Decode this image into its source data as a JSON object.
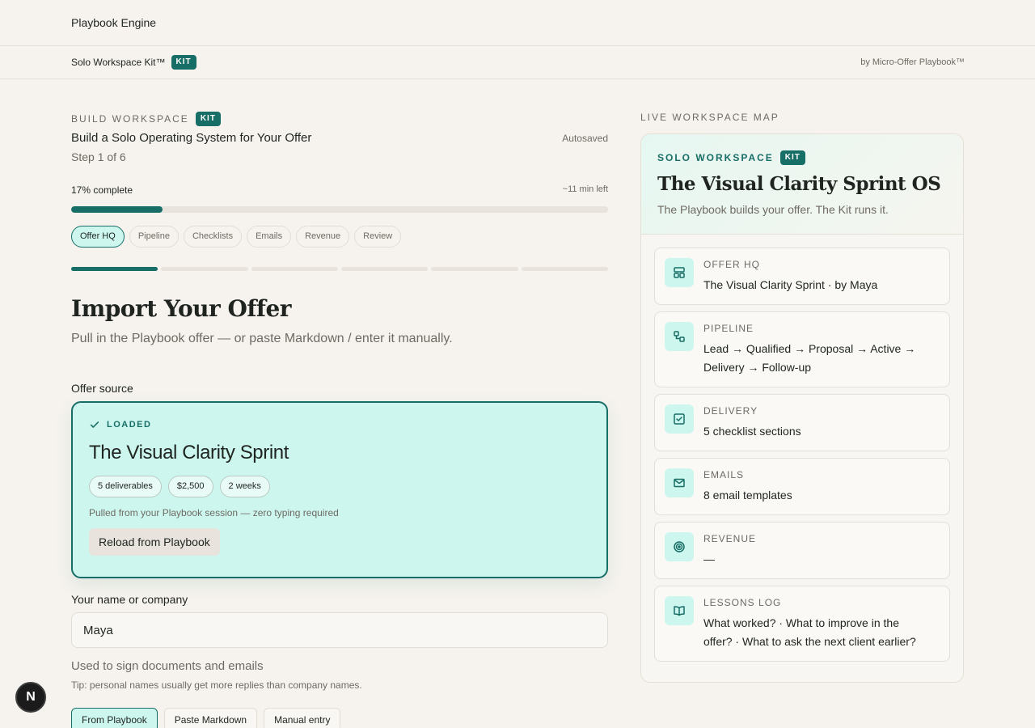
{
  "app": {
    "title": "Playbook Engine"
  },
  "subbar": {
    "product": "Solo Workspace Kit™",
    "kit_badge": "KIT",
    "byline": "by Micro-Offer Playbook™"
  },
  "build": {
    "eyebrow": "BUILD WORKSPACE",
    "badge": "KIT",
    "title": "Build a Solo Operating System for Your Offer",
    "autosaved": "Autosaved",
    "step": "Step 1 of 6",
    "progress_label": "17% complete",
    "progress_value": 17,
    "time_left": "~11 min left"
  },
  "tabs": [
    {
      "label": "Offer HQ",
      "active": true
    },
    {
      "label": "Pipeline",
      "active": false
    },
    {
      "label": "Checklists",
      "active": false
    },
    {
      "label": "Emails",
      "active": false
    },
    {
      "label": "Revenue",
      "active": false
    },
    {
      "label": "Review",
      "active": false
    }
  ],
  "segments_completed": 1,
  "page": {
    "heading": "Import Your Offer",
    "subheading": "Pull in the Playbook offer — or paste Markdown / enter it manually."
  },
  "offer_source": {
    "label": "Offer source",
    "status": "LOADED",
    "title": "The Visual Clarity Sprint",
    "chips": [
      "5 deliverables",
      "$2,500",
      "2 weeks"
    ],
    "note": "Pulled from your Playbook session — zero typing required",
    "reload_label": "Reload from Playbook"
  },
  "name_field": {
    "label": "Your name or company",
    "value": "Maya",
    "hint": "Used to sign documents and emails",
    "tip": "Tip: personal names usually get more replies than company names."
  },
  "source_tabs": [
    {
      "label": "From Playbook",
      "active": true
    },
    {
      "label": "Paste Markdown",
      "active": false
    },
    {
      "label": "Manual entry",
      "active": false
    }
  ],
  "sidebar": {
    "eyebrow": "LIVE WORKSPACE MAP",
    "card_eyebrow": "SOLO WORKSPACE",
    "card_badge": "KIT",
    "title": "The Visual Clarity Sprint OS",
    "subtitle": "The Playbook builds your offer. The Kit runs it.",
    "items": [
      {
        "icon": "layout-icon",
        "label": "OFFER HQ",
        "value": "The Visual Clarity Sprint · by Maya"
      },
      {
        "icon": "workflow-icon",
        "label": "PIPELINE",
        "value": "Lead → Qualified → Proposal → Active → Delivery → Follow-up"
      },
      {
        "icon": "checkbox-icon",
        "label": "DELIVERY",
        "value": "5 checklist sections"
      },
      {
        "icon": "mail-icon",
        "label": "EMAILS",
        "value": "8 email templates"
      },
      {
        "icon": "target-icon",
        "label": "REVENUE",
        "value": "—"
      },
      {
        "icon": "book-open-icon",
        "label": "LESSONS LOG",
        "value": "What worked? · What to improve in the offer? · What to ask the next client earlier?"
      }
    ]
  },
  "dev_badge": {
    "letter": "N"
  },
  "colors": {
    "accent": "#176e66",
    "accent_light": "#cdf7ee",
    "background": "#f6f3ee"
  }
}
